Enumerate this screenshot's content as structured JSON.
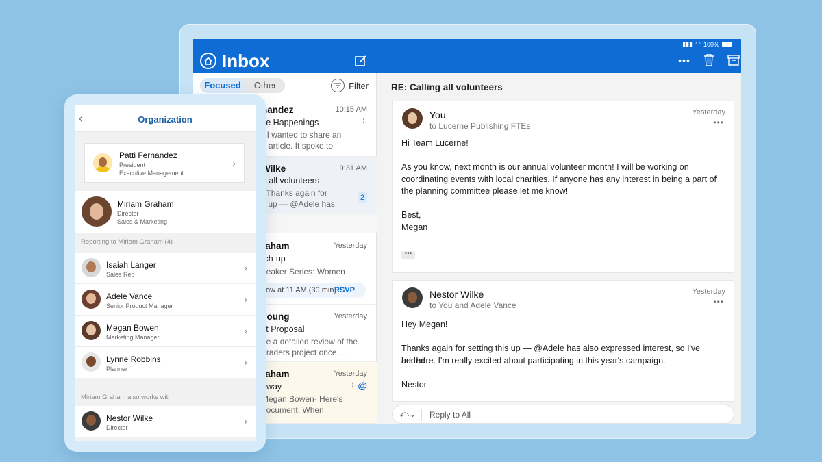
{
  "tablet": {
    "status": {
      "battery": "100%"
    },
    "app_title": "Inbox",
    "tabs": {
      "focused": "Focused",
      "other": "Other"
    },
    "filter_label": "Filter",
    "messages": [
      {
        "sender": "nandez",
        "time": "10:15 AM",
        "subject": "ce Happenings",
        "preview1": "I wanted to share an",
        "preview2": "g article. It spoke to"
      },
      {
        "sender": "Wilke",
        "time": "9:31 AM",
        "subject": "g all volunteers",
        "preview1": "! Thanks again for",
        "preview2": "s up — @Adele has",
        "count": "2"
      },
      {
        "sender": "raham",
        "time": "Yesterday",
        "subject": "tch-up",
        "preview1": "peaker Series: Women",
        "rsvp_text": "ow at 11 AM (30 min)",
        "rsvp": "RSVP"
      },
      {
        "sender": "young",
        "time": "Yesterday",
        "subject": "ct Proposal",
        "preview1": "be a detailed review of the",
        "preview2": "Traders project once ..."
      },
      {
        "sender": "raham",
        "time": "Yesterday",
        "subject": "away",
        "preview1": "Megan Bowen- Here's",
        "preview2": "document. When"
      }
    ],
    "reading": {
      "subject": "RE: Calling all volunteers",
      "emails": [
        {
          "from": "You",
          "to": "to Lucerne Publishing FTEs",
          "date": "Yesterday",
          "greeting": "Hi Team Lucerne!",
          "p1": "As you know, next month is our annual volunteer month! I will be working on",
          "p2": "coordinating events with local charities. If anyone has any interest in being a part of",
          "p3": "the planning committee please let me know!",
          "closing": "Best,",
          "signature": "Megan",
          "more": "•••"
        },
        {
          "from": "Nestor Wilke",
          "to": "to You and Adele Vance",
          "date": "Yesterday",
          "greeting": "Hey Megan!",
          "p1": "Thanks again for setting this up — @Adele has also expressed interest, so I've added",
          "p2": "her here. I'm really excited about participating in this year's campaign.",
          "signature": "Nestor"
        }
      ],
      "reply_label": "Reply to All"
    }
  },
  "phone": {
    "title": "Organization",
    "manager": {
      "name": "Patti Fernandez",
      "role": "President",
      "dept": "Executive Management"
    },
    "me": {
      "name": "Miriam Graham",
      "role": "Director",
      "dept": "Sales & Marketing"
    },
    "reports_label": "Reporting to Miriam Graham (4)",
    "reports": [
      {
        "name": "Isaiah Langer",
        "role": "Sales Rep"
      },
      {
        "name": "Adele Vance",
        "role": "Senior Product Manager"
      },
      {
        "name": "Megan Bowen",
        "role": "Marketing Manager"
      },
      {
        "name": "Lynne Robbins",
        "role": "Planner"
      }
    ],
    "works_with_label": "Miriam Graham also works with",
    "works_with": [
      {
        "name": "Nestor Wilke",
        "role": "Director"
      }
    ]
  },
  "colors": {
    "brand": "#0f6cd4",
    "background": "#8fc3e6"
  }
}
